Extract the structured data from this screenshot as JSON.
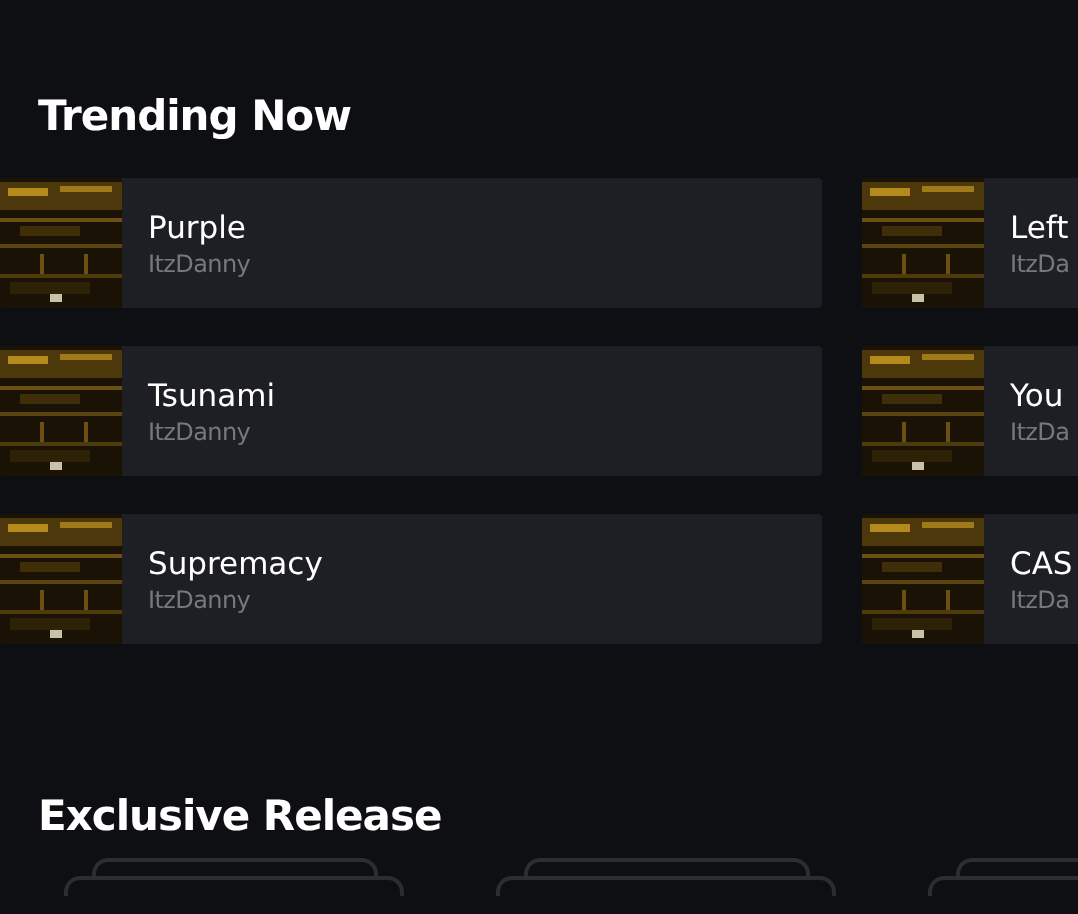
{
  "sections": [
    {
      "title": "Trending Now",
      "kind": "tracks",
      "columns": [
        [
          {
            "title": "Purple",
            "artist": "ItzDanny"
          },
          {
            "title": "Tsunami",
            "artist": "ItzDanny"
          },
          {
            "title": "Supremacy",
            "artist": "ItzDanny"
          }
        ],
        [
          {
            "title": "Left",
            "artist": "ItzDa"
          },
          {
            "title": "You",
            "artist": "ItzDa"
          },
          {
            "title": "CAS",
            "artist": "ItzDa"
          }
        ]
      ]
    },
    {
      "title": "Exclusive Release",
      "kind": "albums",
      "items": [
        {
          "kind": "placeholder"
        },
        {
          "kind": "placeholder"
        },
        {
          "kind": "placeholder"
        }
      ]
    }
  ]
}
